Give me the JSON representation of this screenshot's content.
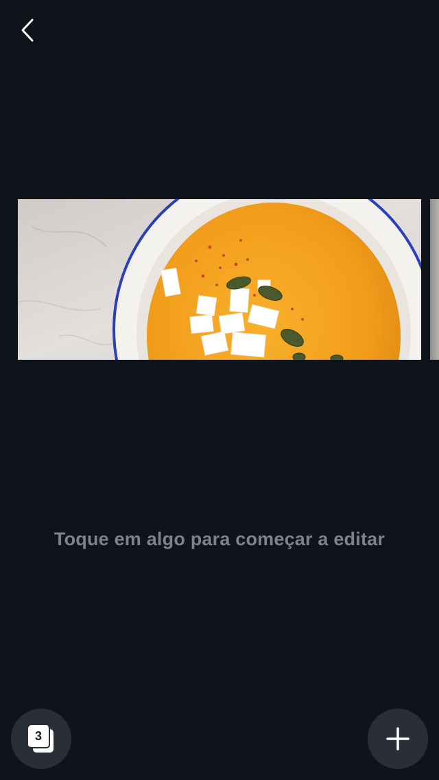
{
  "header": {
    "back_icon": "chevron-left-icon"
  },
  "canvas": {
    "image_subject": "pumpkin-soup-bowl",
    "colors": {
      "background": "#0f131a",
      "soup": "#f2a01e",
      "bowl_rim": "#2233aa",
      "marble": "#dcd9d6"
    }
  },
  "hint": {
    "text": "Toque em algo para começar a editar"
  },
  "footer": {
    "pages_count": "3",
    "pages_icon": "pages-stack-icon",
    "add_icon": "plus-icon"
  }
}
